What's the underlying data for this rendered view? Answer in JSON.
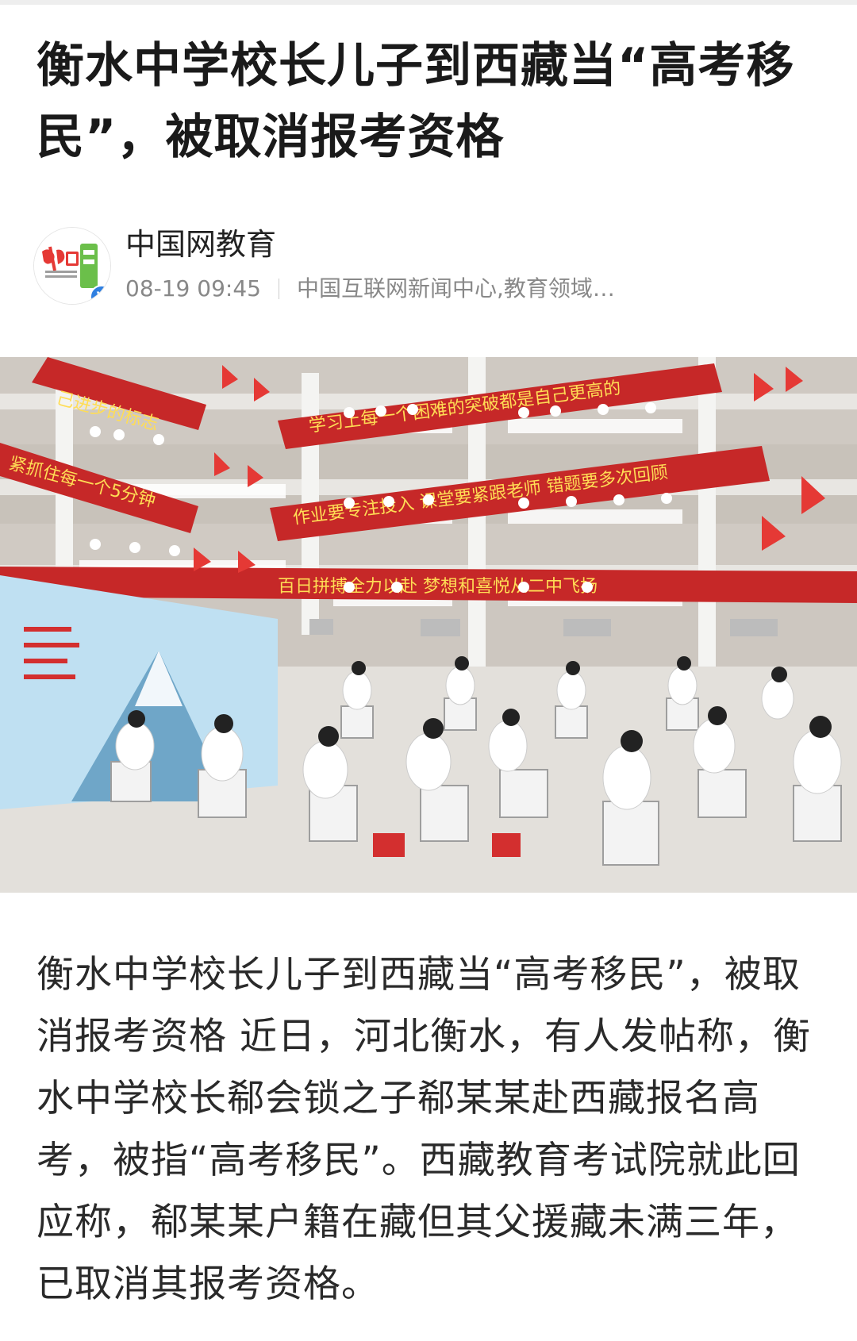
{
  "article": {
    "title": "衡水中学校长儿子到西藏当“高考移民”，被取消报考资格",
    "body": "衡水中学校长儿子到西藏当“高考移民”，被取消报考资格 近日，河北衡水，有人发帖称，衡水中学校长郗会锁之子郗某某赴西藏报名高考，被指“高考移民”。西藏教育考试院就此回应称，郗某某户籍在藏但其父援藏未满三年，已取消其报考资格。"
  },
  "author": {
    "name": "中国网教育",
    "avatar_icon": "china-org-education-logo-icon",
    "verified_icon": "verified-badge-icon",
    "verified_mark": "V",
    "time": "08-19 09:45",
    "description": "中国互联网新闻中心,教育领域…"
  },
  "banners": [
    "己进步的标志",
    "学习上每一个困难的突破都是自己更高的",
    "紧抓住每一个5分钟",
    "作业要专注投入 课堂要紧跟老师 错题要多次回顾",
    "百日拼搏全力以赴 梦想和喜悦从二中飞扬"
  ],
  "colors": {
    "banner_red": "#d32f2f",
    "verified_blue": "#2f7fe0",
    "meta_gray": "#888888"
  }
}
